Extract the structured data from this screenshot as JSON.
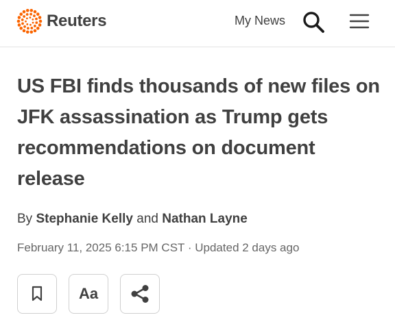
{
  "header": {
    "brand": "Reuters",
    "my_news_label": "My News",
    "icons": {
      "logo": "reuters-dot-ring-icon",
      "search": "search-icon",
      "menu": "hamburger-menu-icon"
    },
    "brand_color": "#fa6400"
  },
  "article": {
    "headline": "US FBI finds thousands of new files on JFK assassination as Trump gets recommendations on document release",
    "byline": {
      "prefix": "By",
      "author1": "Stephanie Kelly",
      "connector": "and",
      "author2": "Nathan Layne"
    },
    "published": "February 11, 2025 6:15 PM CST",
    "separator": "·",
    "updated": "Updated 2 days ago"
  },
  "toolbar": {
    "bookmark_icon": "bookmark-icon",
    "text_size_label": "Aa",
    "share_icon": "share-icon"
  }
}
